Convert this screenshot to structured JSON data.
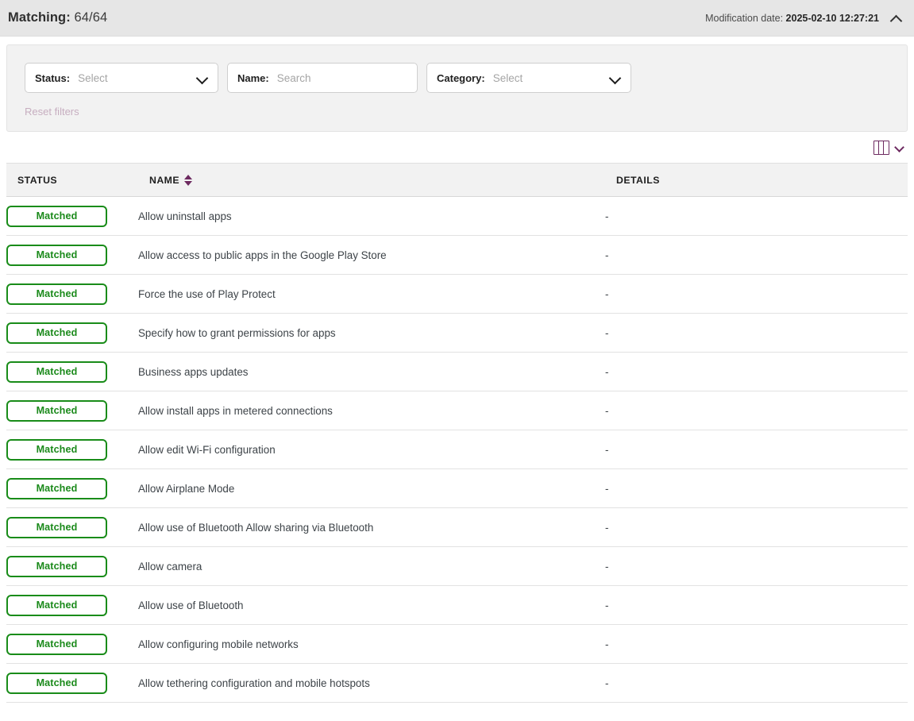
{
  "summary": {
    "matching_label": "Matching:",
    "matching_value": "64/64",
    "modification_label": "Modification date:",
    "modification_value": "2025-02-10 12:27:21",
    "collapse_icon": "chevron-up-icon"
  },
  "filters": {
    "status": {
      "label": "Status:",
      "placeholder": "Select",
      "value": "",
      "icon": "chevron-down-icon"
    },
    "name": {
      "label": "Name:",
      "placeholder": "Search",
      "value": ""
    },
    "category": {
      "label": "Category:",
      "placeholder": "Select",
      "value": "",
      "icon": "chevron-down-icon"
    },
    "reset_label": "Reset filters"
  },
  "toolbar": {
    "columns_icon": "columns-icon",
    "columns_chevron": "chevron-down-icon"
  },
  "table": {
    "columns": [
      {
        "key": "status",
        "label": "STATUS",
        "sortable": false
      },
      {
        "key": "name",
        "label": "NAME",
        "sortable": true
      },
      {
        "key": "details",
        "label": "DETAILS",
        "sortable": false
      }
    ],
    "rows": [
      {
        "status": "Matched",
        "name": "Allow uninstall apps",
        "details": "-"
      },
      {
        "status": "Matched",
        "name": "Allow access to public apps in the Google Play Store",
        "details": "-"
      },
      {
        "status": "Matched",
        "name": "Force the use of Play Protect",
        "details": "-"
      },
      {
        "status": "Matched",
        "name": "Specify how to grant permissions for apps",
        "details": "-"
      },
      {
        "status": "Matched",
        "name": "Business apps updates",
        "details": "-"
      },
      {
        "status": "Matched",
        "name": "Allow install apps in metered connections",
        "details": "-"
      },
      {
        "status": "Matched",
        "name": "Allow edit Wi-Fi configuration",
        "details": "-"
      },
      {
        "status": "Matched",
        "name": "Allow Airplane Mode",
        "details": "-"
      },
      {
        "status": "Matched",
        "name": "Allow use of Bluetooth Allow sharing via Bluetooth",
        "details": "-"
      },
      {
        "status": "Matched",
        "name": "Allow camera",
        "details": "-"
      },
      {
        "status": "Matched",
        "name": "Allow use of Bluetooth",
        "details": "-"
      },
      {
        "status": "Matched",
        "name": "Allow configuring mobile networks",
        "details": "-"
      },
      {
        "status": "Matched",
        "name": "Allow tethering configuration and mobile hotspots",
        "details": "-"
      }
    ]
  },
  "colors": {
    "matched_green": "#1b8a1b",
    "accent_purple": "#6d2a60",
    "header_bg": "#e6e6e6",
    "panel_bg": "#f2f2f2",
    "reset_disabled": "#c7aec0"
  }
}
